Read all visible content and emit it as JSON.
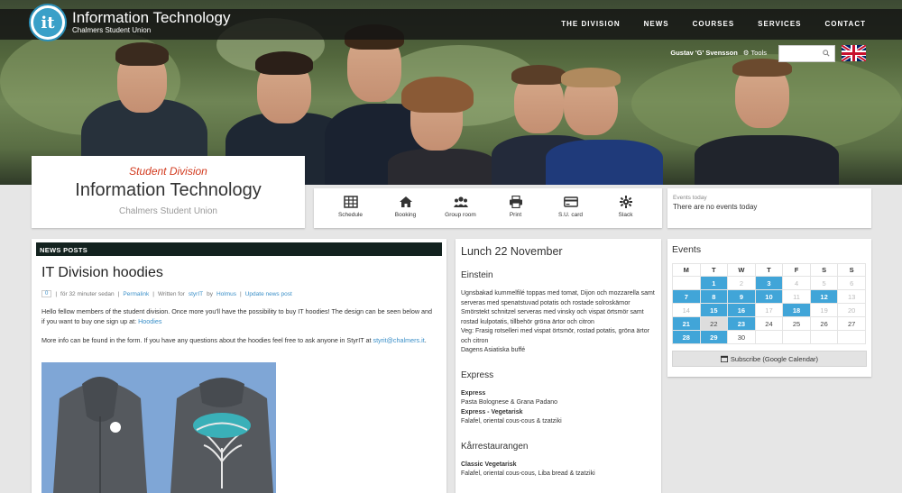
{
  "site": {
    "title": "Information Technology",
    "subtitle": "Chalmers Student Union",
    "logo_text": "it"
  },
  "nav": [
    "THE DIVISION",
    "NEWS",
    "COURSES",
    "SERVICES",
    "CONTACT"
  ],
  "user": {
    "name": "Gustav 'G' Svensson",
    "tools_label": "Tools"
  },
  "search": {
    "placeholder": ""
  },
  "brand": {
    "division": "Student Division",
    "name": "Information Technology",
    "union": "Chalmers Student Union"
  },
  "quick_links": [
    {
      "label": "Schedule",
      "icon": "calendar-grid-icon"
    },
    {
      "label": "Booking",
      "icon": "home-icon"
    },
    {
      "label": "Group room",
      "icon": "group-icon"
    },
    {
      "label": "Print",
      "icon": "printer-icon"
    },
    {
      "label": "S.U. card",
      "icon": "credit-card-icon"
    },
    {
      "label": "Slack",
      "icon": "slack-icon"
    }
  ],
  "events_today": {
    "label": "Events today",
    "text": "There are no events today"
  },
  "news": {
    "section_label": "NEWS POSTS",
    "title": "IT Division hoodies",
    "comment_count": "0",
    "time": "för 32 minuter sedan",
    "permalink": "Permalink",
    "written_by": "Written for",
    "author_group": "styrIT",
    "by": "by",
    "author": "Holmus",
    "update": "Update news post",
    "para1": "Hello fellow members of the student division. Once more you'll have the possibility to buy IT hoodies! The design can be seen below and if you want to buy one sign up at:",
    "para1_link": "Hoodies",
    "para2": "More info can be found in the form. If you have any questions about the hoodies feel free to ask anyone in StyrIT at",
    "para2_link": "styrit@chalmers.it",
    "para2_end": "."
  },
  "lunch": {
    "title": "Lunch 22 November",
    "restaurants": [
      {
        "name": "Einstein",
        "items": [
          {
            "bold": false,
            "text": "Ugnsbakad kummelfilé toppas med tomat, Dijon och mozzarella samt serveras med spenatstuvad potatis och rostade solroskärnor"
          },
          {
            "bold": false,
            "text": "Smörstekt schnitzel serveras med vinsky och vispat örtsmör samt rostad  kulpotatis, tillbehör gröna ärtor och citron"
          },
          {
            "bold": false,
            "text": "Veg: Frasig rotselleri med vispat örtsmör, rostad potatis, gröna ärtor och citron"
          },
          {
            "bold": false,
            "text": "Dagens Asiatiska buffé"
          }
        ]
      },
      {
        "name": "Express",
        "items": [
          {
            "bold": true,
            "text": "Express"
          },
          {
            "bold": false,
            "text": "Pasta Bolognese & Grana Padano"
          },
          {
            "bold": true,
            "text": "Express - Vegetarisk"
          },
          {
            "bold": false,
            "text": "Falafel, oriental cous-cous & tzatziki"
          }
        ]
      },
      {
        "name": "Kårrestaurangen",
        "items": [
          {
            "bold": true,
            "text": "Classic Vegetarisk"
          },
          {
            "bold": false,
            "text": "Falafel, oriental cous-cous, Liba bread & tzatziki"
          }
        ]
      }
    ]
  },
  "events": {
    "title": "Events",
    "weekdays": [
      "M",
      "T",
      "W",
      "T",
      "F",
      "S",
      "S"
    ],
    "weeks": [
      [
        {
          "d": "",
          "s": ""
        },
        {
          "d": "1",
          "s": "ev"
        },
        {
          "d": "2",
          "s": "mut"
        },
        {
          "d": "3",
          "s": "ev"
        },
        {
          "d": "4",
          "s": "mut"
        },
        {
          "d": "5",
          "s": "mut"
        },
        {
          "d": "6",
          "s": "mut"
        }
      ],
      [
        {
          "d": "7",
          "s": "ev"
        },
        {
          "d": "8",
          "s": "ev"
        },
        {
          "d": "9",
          "s": "ev"
        },
        {
          "d": "10",
          "s": "ev"
        },
        {
          "d": "11",
          "s": "mut"
        },
        {
          "d": "12",
          "s": "ev"
        },
        {
          "d": "13",
          "s": "mut"
        }
      ],
      [
        {
          "d": "14",
          "s": "mut"
        },
        {
          "d": "15",
          "s": "ev"
        },
        {
          "d": "16",
          "s": "ev"
        },
        {
          "d": "17",
          "s": "mut"
        },
        {
          "d": "18",
          "s": "ev"
        },
        {
          "d": "19",
          "s": "mut"
        },
        {
          "d": "20",
          "s": "mut"
        }
      ],
      [
        {
          "d": "21",
          "s": "ev"
        },
        {
          "d": "22",
          "s": "today"
        },
        {
          "d": "23",
          "s": "ev"
        },
        {
          "d": "24",
          "s": ""
        },
        {
          "d": "25",
          "s": ""
        },
        {
          "d": "26",
          "s": ""
        },
        {
          "d": "27",
          "s": ""
        }
      ],
      [
        {
          "d": "28",
          "s": "ev"
        },
        {
          "d": "29",
          "s": "ev"
        },
        {
          "d": "30",
          "s": ""
        },
        {
          "d": "",
          "s": ""
        },
        {
          "d": "",
          "s": ""
        },
        {
          "d": "",
          "s": ""
        },
        {
          "d": "",
          "s": ""
        }
      ]
    ],
    "subscribe_label": "Subscribe (Google Calendar)"
  }
}
